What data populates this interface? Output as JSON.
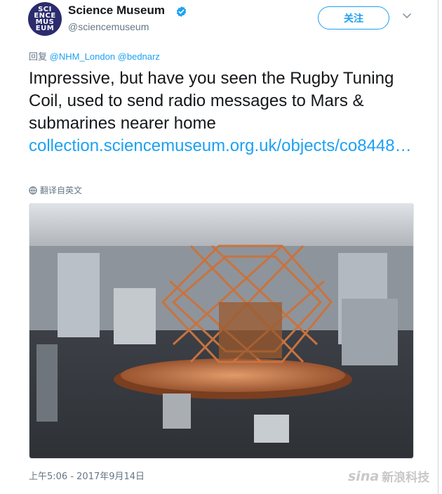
{
  "header": {
    "avatar_text": "SCI\nENCE\nMUS\nEUM",
    "display_name": "Science Museum",
    "handle": "@sciencemuseum",
    "follow_label": "关注",
    "verified_icon": "verified-badge-icon",
    "caret_icon": "chevron-down-icon"
  },
  "tweet": {
    "reply_prefix": "回复",
    "reply_mentions": "@NHM_London @bednarz",
    "text": "Impressive, but have you seen the Rugby Tuning Coil, used to send radio messages to Mars & submarines nearer home",
    "link": "collection.sciencemuseum.org.uk/objects/co8448…",
    "translate_label": "翻译自英文",
    "timestamp": "上午5:06 - 2017年9月14日"
  },
  "watermark": {
    "brand": "sina",
    "text": "新浪科技"
  },
  "colors": {
    "accent": "#1da1f2",
    "secondary_text": "#657786",
    "primary_text": "#14171a"
  }
}
